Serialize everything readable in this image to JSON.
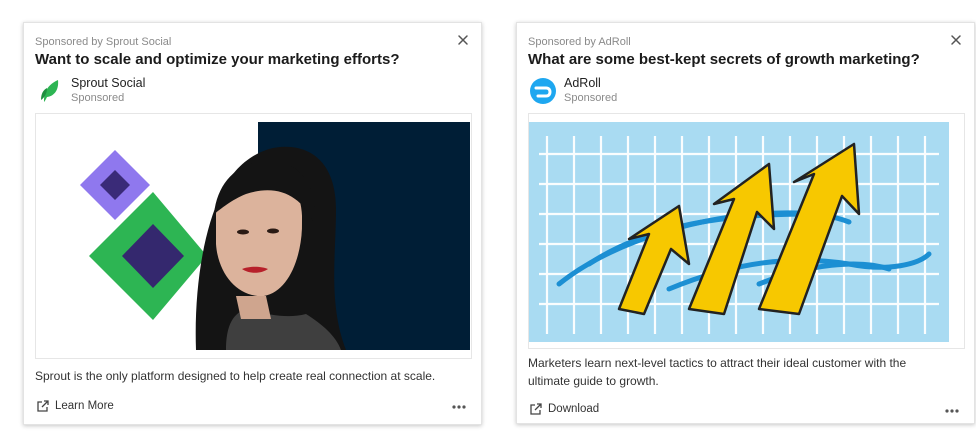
{
  "ads": [
    {
      "sponsor_line": "Sponsored by Sprout Social",
      "headline": "Want to scale and optimize your marketing efforts?",
      "advertiser": "Sprout Social",
      "advertiser_sub": "Sponsored",
      "logo_icon": "sprout-leaf-icon",
      "body": "Sprout is the only platform designed to help create real connection at scale.",
      "cta_label": "Learn More",
      "colors": {
        "accent": "#2db553",
        "purple": "#8f78ee",
        "navy": "#001e36"
      }
    },
    {
      "sponsor_line": "Sponsored by AdRoll",
      "headline": "What are some best-kept secrets of growth marketing?",
      "advertiser": "AdRoll",
      "advertiser_sub": "Sponsored",
      "logo_icon": "adroll-logo-icon",
      "body": "Marketers learn next-level tactics to attract their ideal customer with the ultimate guide to growth.",
      "cta_label": "Download",
      "colors": {
        "accent": "#1ea7f0",
        "sky": "#a9dbf2",
        "arrow": "#f7c800"
      }
    }
  ]
}
